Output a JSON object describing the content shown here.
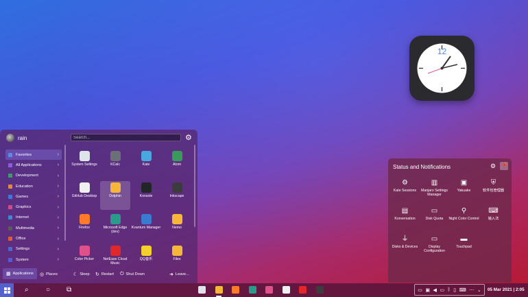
{
  "launcher": {
    "user_name": "rain",
    "search_placeholder": "Search...",
    "categories": [
      {
        "label": "Favorites",
        "color": "#5b8ae8",
        "active": true
      },
      {
        "label": "All Applications",
        "color": "#8a5ee0"
      },
      {
        "label": "Development",
        "color": "#3a9a6a"
      },
      {
        "label": "Education",
        "color": "#e08a3a"
      },
      {
        "label": "Games",
        "color": "#3a7ae0"
      },
      {
        "label": "Graphics",
        "color": "#d04a8a"
      },
      {
        "label": "Internet",
        "color": "#3a8ad0"
      },
      {
        "label": "Multimedia",
        "color": "#5a5a5a"
      },
      {
        "label": "Office",
        "color": "#e05a3a"
      },
      {
        "label": "Settings",
        "color": "#4a6ad0"
      },
      {
        "label": "System",
        "color": "#5a5ad0"
      }
    ],
    "apps": [
      {
        "label": "System Settings",
        "color": "#dfe4ea"
      },
      {
        "label": "KCalc",
        "color": "#6a6f78"
      },
      {
        "label": "Kate",
        "color": "#4aa8e0"
      },
      {
        "label": "Atom",
        "color": "#3a9a5a"
      },
      {
        "label": "GitHub Desktop",
        "color": "#f0f0f0"
      },
      {
        "label": "Dolphin",
        "color": "#f5b63a",
        "selected": true
      },
      {
        "label": "Konsole",
        "color": "#232629"
      },
      {
        "label": "Inkscape",
        "color": "#3c3c3c"
      },
      {
        "label": "Firefox",
        "color": "#ff7b2a"
      },
      {
        "label": "Microsoft Edge (dev)",
        "color": "#2a9a8a"
      },
      {
        "label": "Kvantum Manager",
        "color": "#3a7ad0"
      },
      {
        "label": "Nemo",
        "color": "#f5b63a"
      },
      {
        "label": "Color Picker",
        "color": "#e0508a"
      },
      {
        "label": "NetEase Cloud Music",
        "color": "#e0282a"
      },
      {
        "label": "QQ音乐",
        "color": "#f5d02a"
      },
      {
        "label": "Files",
        "color": "#f5b63a"
      }
    ],
    "footer": {
      "applications": "Applications",
      "places": "Places",
      "sleep": "Sleep",
      "restart": "Restart",
      "shutdown": "Shut Down",
      "leave": "Leave..."
    }
  },
  "status_panel": {
    "title": "Status and Notifications",
    "items": [
      {
        "label": "Kate Sessions",
        "icon": "kate-sessions-icon",
        "glyph": "⚙"
      },
      {
        "label": "Manjaro Settings Manager",
        "icon": "manjaro-icon",
        "glyph": "▥"
      },
      {
        "label": "Yakuake",
        "icon": "terminal-icon",
        "glyph": "▣"
      },
      {
        "label": "软件包管理器",
        "icon": "shield-icon",
        "glyph": "⛨"
      },
      {
        "label": "Konversation",
        "icon": "chat-icon",
        "glyph": "▤"
      },
      {
        "label": "Disk Quota",
        "icon": "disk-icon",
        "glyph": "▭"
      },
      {
        "label": "Night Color Control",
        "icon": "lightbulb-icon",
        "glyph": "⚲"
      },
      {
        "label": "输入法",
        "icon": "keyboard-icon",
        "glyph": "⌨"
      },
      {
        "label": "Disks & Devices",
        "icon": "usb-icon",
        "glyph": "⏚"
      },
      {
        "label": "Display Configuration",
        "icon": "monitor-icon",
        "glyph": "▭"
      },
      {
        "label": "Touchpad",
        "icon": "touchpad-icon",
        "glyph": "▬"
      }
    ]
  },
  "taskbar": {
    "clock_text": "05 Mar 2021 | 2:05",
    "apps": [
      {
        "name": "settings",
        "color": "#dfe4ea"
      },
      {
        "name": "files",
        "color": "#f5b63a",
        "active": true
      },
      {
        "name": "firefox",
        "color": "#ff7b2a"
      },
      {
        "name": "edge",
        "color": "#2a9a8a"
      },
      {
        "name": "color-picker",
        "color": "#e0508a"
      },
      {
        "name": "github",
        "color": "#f0f0f0"
      },
      {
        "name": "netease-music",
        "color": "#e0282a"
      },
      {
        "name": "inkscape",
        "color": "#3c3c3c"
      }
    ],
    "tray_icons": [
      "chat-icon",
      "clipboard-icon",
      "volume-icon",
      "battery-icon",
      "bluetooth-icon",
      "phone-icon",
      "keyboard-icon",
      "network-icon",
      "chevron-up-icon"
    ],
    "tray_glyphs": [
      "▭",
      "▣",
      "◀",
      "▭",
      "ᛒ",
      "▯",
      "⌨",
      "⋯",
      "⌄"
    ]
  },
  "colors": {
    "accent": "#5b8ae8",
    "clock_second_hand": "#e0508a"
  }
}
